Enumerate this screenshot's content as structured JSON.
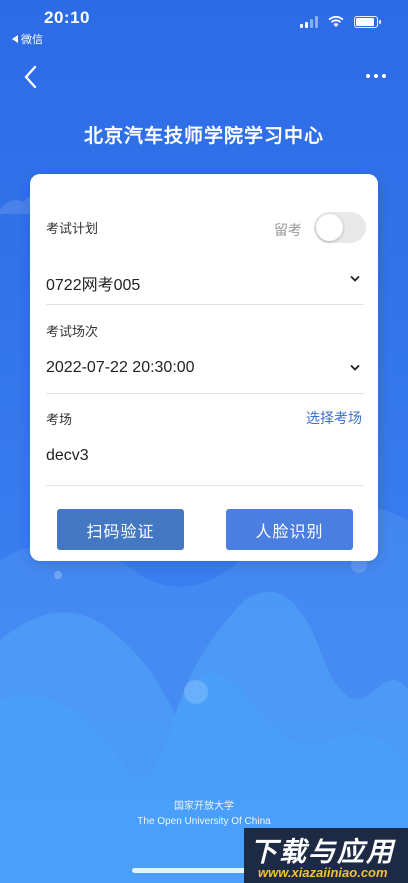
{
  "status_bar": {
    "time": "20:10",
    "back_app": "微信"
  },
  "nav": {
    "back_icon": "chevron-left-icon",
    "more_icon": "more-dots-icon"
  },
  "page": {
    "title": "北京汽车技师学院学习中心"
  },
  "form": {
    "exam_plan_label": "考试计划",
    "retain_label": "留考",
    "retain_on": false,
    "exam_plan_value": "0722网考005",
    "session_label": "考试场次",
    "session_value": "2022-07-22 20:30:00",
    "venue_label": "考场",
    "select_venue_link": "选择考场",
    "venue_value": "decv3"
  },
  "actions": {
    "scan_label": "扫码验证",
    "face_label": "人脸识别"
  },
  "footer": {
    "line1": "国家开放大学",
    "line2": "The Open University Of China"
  },
  "watermark": {
    "big": "下载与应用",
    "small": "www.xiazaiiniao.com"
  },
  "colors": {
    "background": "#2f6fe6",
    "scan_button": "#4478c3",
    "face_button": "#4a7ee0",
    "link": "#3c6fcb"
  }
}
